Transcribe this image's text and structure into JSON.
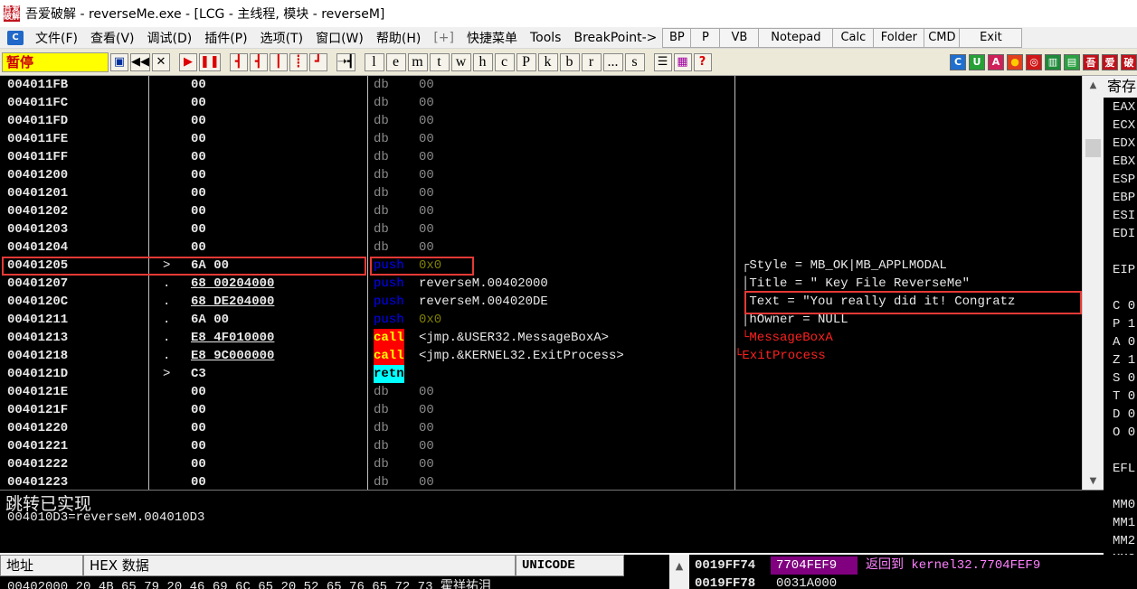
{
  "window": {
    "title": "吾爱破解 - reverseMe.exe - [LCG -  主线程, 模块 - reverseM]",
    "logo": "吾爱破解"
  },
  "menubar": {
    "sys_icon": "C",
    "items": [
      "文件(F)",
      "查看(V)",
      "调试(D)",
      "插件(P)",
      "选项(T)",
      "窗口(W)",
      "帮助(H)",
      "[+]",
      "快捷菜单",
      "Tools",
      "BreakPoint->"
    ],
    "buttons": [
      "BP",
      "P",
      "VB",
      "Notepad",
      "Calc",
      "Folder",
      "CMD",
      "Exit"
    ]
  },
  "toolbar": {
    "status": "暂停",
    "play_buttons": [
      "▣",
      "◀◀",
      "✕",
      "▶",
      "❚❚",
      "┫",
      "┫",
      "┃",
      "┋",
      "┛",
      "➝┫"
    ],
    "letter_buttons": [
      "l",
      "e",
      "m",
      "t",
      "w",
      "h",
      "c",
      "P",
      "k",
      "b",
      "r",
      "...",
      "s"
    ],
    "right_buttons": [
      "☰",
      "▦",
      "?"
    ],
    "right_icons": [
      "C",
      "U",
      "A",
      "●",
      "◎",
      "▥",
      "▤",
      "吾",
      "爱",
      "破"
    ]
  },
  "colors": {
    "push": "#0000ff",
    "push_op": "#808000",
    "call_bg": "#ff0000",
    "call_fg": "#ffff00",
    "retn_bg": "#00ffff",
    "api_comment": "#ff2020",
    "highlight_box": "#e53935",
    "pause_bg": "#ffff00"
  },
  "disasm": [
    {
      "addr": "004011FB",
      "mark": "",
      "hex": "00",
      "mn": "db",
      "op": "00",
      "cm": ""
    },
    {
      "addr": "004011FC",
      "mark": "",
      "hex": "00",
      "mn": "db",
      "op": "00",
      "cm": ""
    },
    {
      "addr": "004011FD",
      "mark": "",
      "hex": "00",
      "mn": "db",
      "op": "00",
      "cm": ""
    },
    {
      "addr": "004011FE",
      "mark": "",
      "hex": "00",
      "mn": "db",
      "op": "00",
      "cm": ""
    },
    {
      "addr": "004011FF",
      "mark": "",
      "hex": "00",
      "mn": "db",
      "op": "00",
      "cm": ""
    },
    {
      "addr": "00401200",
      "mark": "",
      "hex": "00",
      "mn": "db",
      "op": "00",
      "cm": ""
    },
    {
      "addr": "00401201",
      "mark": "",
      "hex": "00",
      "mn": "db",
      "op": "00",
      "cm": ""
    },
    {
      "addr": "00401202",
      "mark": "",
      "hex": "00",
      "mn": "db",
      "op": "00",
      "cm": ""
    },
    {
      "addr": "00401203",
      "mark": "",
      "hex": "00",
      "mn": "db",
      "op": "00",
      "cm": ""
    },
    {
      "addr": "00401204",
      "mark": "",
      "hex": "00",
      "mn": "db",
      "op": "00",
      "cm": ""
    },
    {
      "addr": "00401205",
      "mark": ">",
      "hex": "6A 00",
      "mn": "push",
      "op": "0x0",
      "cm": "┌Style = MB_OK|MB_APPLMODAL"
    },
    {
      "addr": "00401207",
      "mark": ".",
      "hex": "68 00204000",
      "mn": "push",
      "op": "reverseM.00402000",
      "cm": "│Title = \" Key File ReverseMe\""
    },
    {
      "addr": "0040120C",
      "mark": ".",
      "hex": "68 DE204000",
      "mn": "push",
      "op": "reverseM.004020DE",
      "cm": "│Text = \"You really did it! Congratz"
    },
    {
      "addr": "00401211",
      "mark": ".",
      "hex": "6A 00",
      "mn": "push",
      "op": "0x0",
      "cm": "│hOwner = NULL"
    },
    {
      "addr": "00401213",
      "mark": ".",
      "hex": "E8 4F010000",
      "mn": "call",
      "op": "<jmp.&USER32.MessageBoxA>",
      "cm": "└MessageBoxA"
    },
    {
      "addr": "00401218",
      "mark": ".",
      "hex": "E8 9C000000",
      "mn": "call",
      "op": "<jmp.&KERNEL32.ExitProcess>",
      "cm": "└ExitProcess"
    },
    {
      "addr": "0040121D",
      "mark": ">",
      "hex": "C3",
      "mn": "retn",
      "op": "",
      "cm": ""
    },
    {
      "addr": "0040121E",
      "mark": "",
      "hex": "00",
      "mn": "db",
      "op": "00",
      "cm": ""
    },
    {
      "addr": "0040121F",
      "mark": "",
      "hex": "00",
      "mn": "db",
      "op": "00",
      "cm": ""
    },
    {
      "addr": "00401220",
      "mark": "",
      "hex": "00",
      "mn": "db",
      "op": "00",
      "cm": ""
    },
    {
      "addr": "00401221",
      "mark": "",
      "hex": "00",
      "mn": "db",
      "op": "00",
      "cm": ""
    },
    {
      "addr": "00401222",
      "mark": "",
      "hex": "00",
      "mn": "db",
      "op": "00",
      "cm": ""
    },
    {
      "addr": "00401223",
      "mark": "",
      "hex": "00",
      "mn": "db",
      "op": "00",
      "cm": ""
    }
  ],
  "registers": {
    "header": "寄存",
    "items": [
      "EAX",
      "ECX",
      "EDX",
      "EBX",
      "ESP",
      "EBP",
      "ESI",
      "EDI",
      "",
      "EIP",
      "",
      "C 0",
      "P 1",
      "A 0",
      "Z 1",
      "S 0",
      "T 0",
      "D 0",
      "O 0",
      "",
      "EFL",
      "",
      "MM0",
      "MM1",
      "MM2",
      "MM3",
      "MM4"
    ]
  },
  "info": {
    "line1": "跳转已实现",
    "line2": "004010D3=reverseM.004010D3"
  },
  "dump": {
    "headers": [
      "地址",
      "HEX 数据",
      "UNICODE"
    ],
    "row": "00402000 20 4B 65 79 20 46 69 6C 65 20 52 65 76 65 72 73 霍祥祐泪"
  },
  "stack": [
    {
      "addr": "0019FF74",
      "val": "7704FEF9",
      "cm": "返回到 kernel32.7704FEF9"
    },
    {
      "addr": "0019FF78",
      "val": "0031A000",
      "cm": ""
    }
  ]
}
